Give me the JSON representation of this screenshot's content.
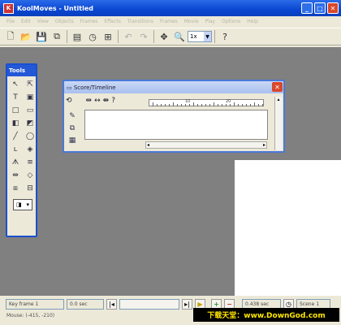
{
  "window": {
    "title": "KoolMoves - Untitled"
  },
  "menus": [
    "File",
    "Edit",
    "View",
    "Objects",
    "Frames",
    "Effects",
    "Transitions",
    "Frames",
    "Movie",
    "Play",
    "Options",
    "Help"
  ],
  "toolbar": {
    "zoom_value": "1x"
  },
  "tools_panel": {
    "title": "Tools"
  },
  "score": {
    "title": "Score/Timeline",
    "ruler_labels": [
      "10",
      "20"
    ]
  },
  "status": {
    "keyframe": "Key frame 1",
    "time": "0.0 sec",
    "total_time": "0.438 sec",
    "scene": "Scene 1",
    "mouse": "Mouse: (-415, -210)"
  },
  "watermark": "下载天堂：www.DownGod.com"
}
